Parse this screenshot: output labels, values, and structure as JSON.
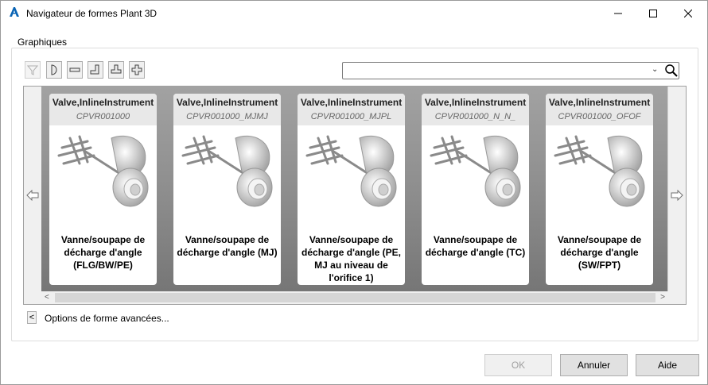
{
  "window": {
    "title": "Navigateur de formes Plant 3D",
    "app_icon": "autocad-a-icon",
    "controls": [
      "minimize-icon",
      "maximize-icon",
      "close-icon"
    ]
  },
  "group": {
    "label": "Graphiques"
  },
  "toolbar": {
    "buttons": [
      "filter-icon",
      "half-round-icon",
      "straight-icon",
      "elbow-icon",
      "tee-icon",
      "cross-icon"
    ],
    "search": {
      "value": "",
      "placeholder": ""
    }
  },
  "cards": [
    {
      "type": "Valve,InlineInstrument",
      "code": "CPVR001000",
      "description": "Vanne/soupape de décharge d'angle (FLG/BW/PE)"
    },
    {
      "type": "Valve,InlineInstrument",
      "code": "CPVR001000_MJMJ",
      "description": "Vanne/soupape de décharge d'angle (MJ)"
    },
    {
      "type": "Valve,InlineInstrument",
      "code": "CPVR001000_MJPL",
      "description": "Vanne/soupape de décharge d'angle (PE, MJ au niveau de l'orifice 1)"
    },
    {
      "type": "Valve,InlineInstrument",
      "code": "CPVR001000_N_N_",
      "description": "Vanne/soupape de décharge d'angle (TC)"
    },
    {
      "type": "Valve,InlineInstrument",
      "code": "CPVR001000_OFOF",
      "description": "Vanne/soupape de décharge d'angle (SW/FPT)"
    }
  ],
  "advanced": {
    "toggle": "<",
    "label": "Options de forme avancées..."
  },
  "buttons": {
    "ok": "OK",
    "cancel": "Annuler",
    "help": "Aide"
  },
  "colors": {
    "accent": "#0a64b4",
    "gallery_bg": "#8c8c8c",
    "card_header": "#e8e8e8"
  }
}
